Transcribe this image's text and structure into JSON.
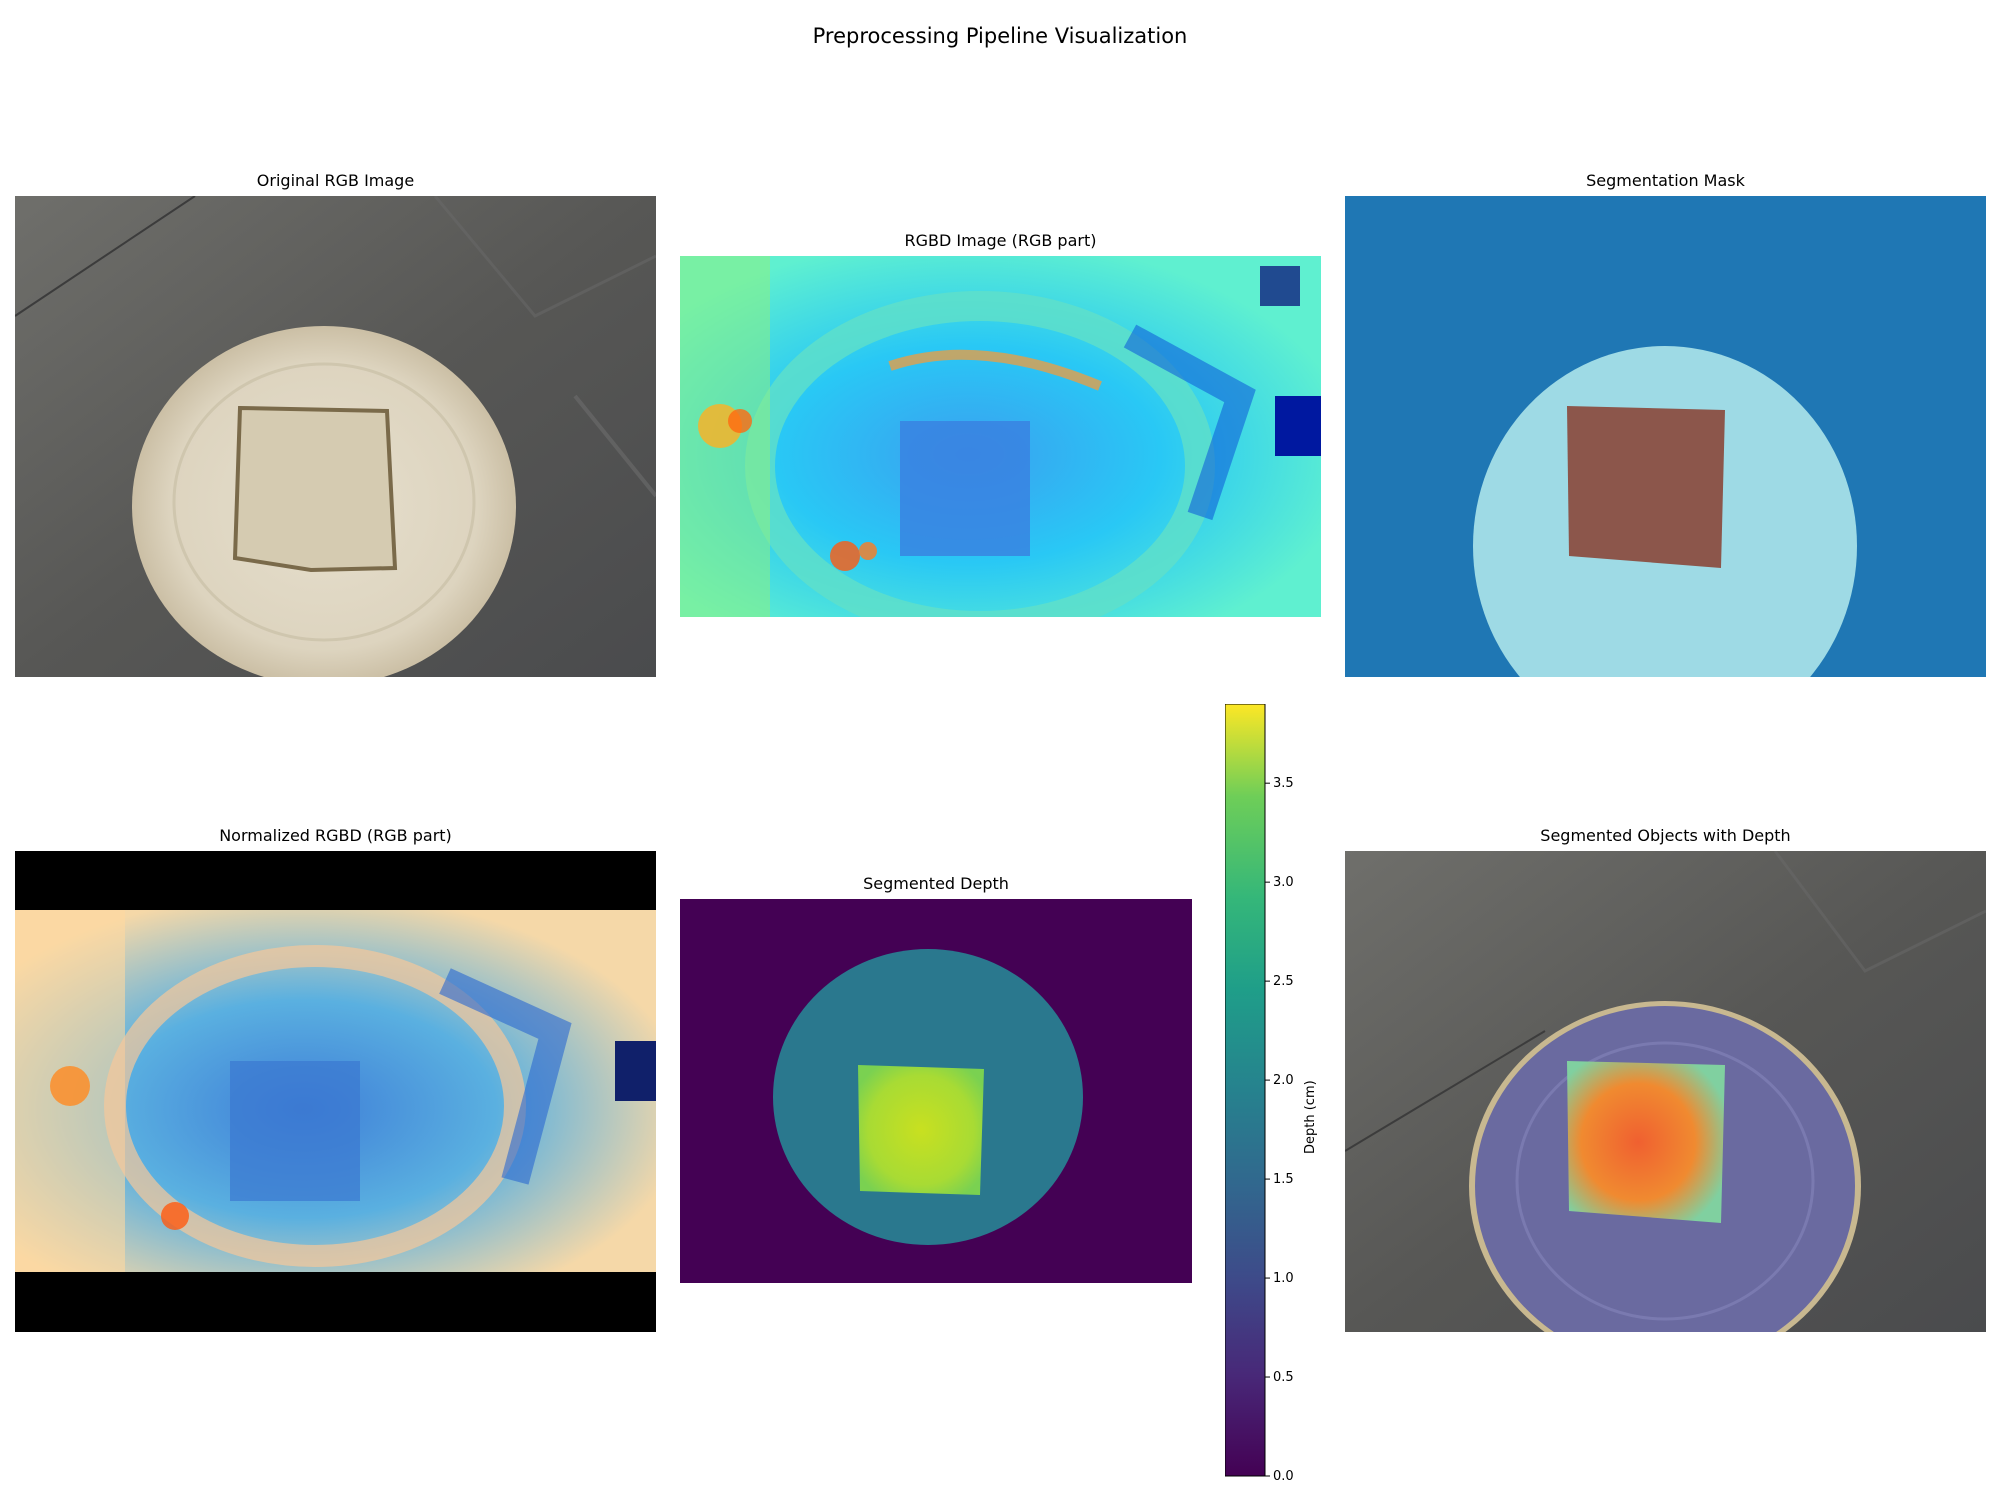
{
  "figure": {
    "title": "Preprocessing Pipeline Visualization"
  },
  "panels": {
    "original": {
      "title": "Original RGB Image"
    },
    "rgbd": {
      "title": "RGBD Image (RGB part)"
    },
    "mask": {
      "title": "Segmentation Mask"
    },
    "normalized": {
      "title": "Normalized RGBD (RGB part)"
    },
    "segdepth": {
      "title": "Segmented Depth"
    },
    "overlay": {
      "title": "Segmented Objects with Depth"
    }
  },
  "chart_data": {
    "type": "heatmap",
    "colorbar": {
      "label": "Depth (cm)",
      "colormap": "viridis",
      "range": [
        0.0,
        3.9
      ],
      "ticks": [
        0.0,
        0.5,
        1.0,
        1.5,
        2.0,
        2.5,
        3.0,
        3.5
      ],
      "tick_labels": [
        "0.0",
        "0.5",
        "1.0",
        "1.5",
        "2.0",
        "2.5",
        "3.0",
        "3.5"
      ]
    },
    "colors": {
      "mask_background": "#1f77b4",
      "mask_plate": "#9edae5",
      "mask_bread": "#8c564b",
      "depth_background": "#440154",
      "depth_plate": "#2a788e",
      "depth_bread": "#b5de2b"
    }
  }
}
